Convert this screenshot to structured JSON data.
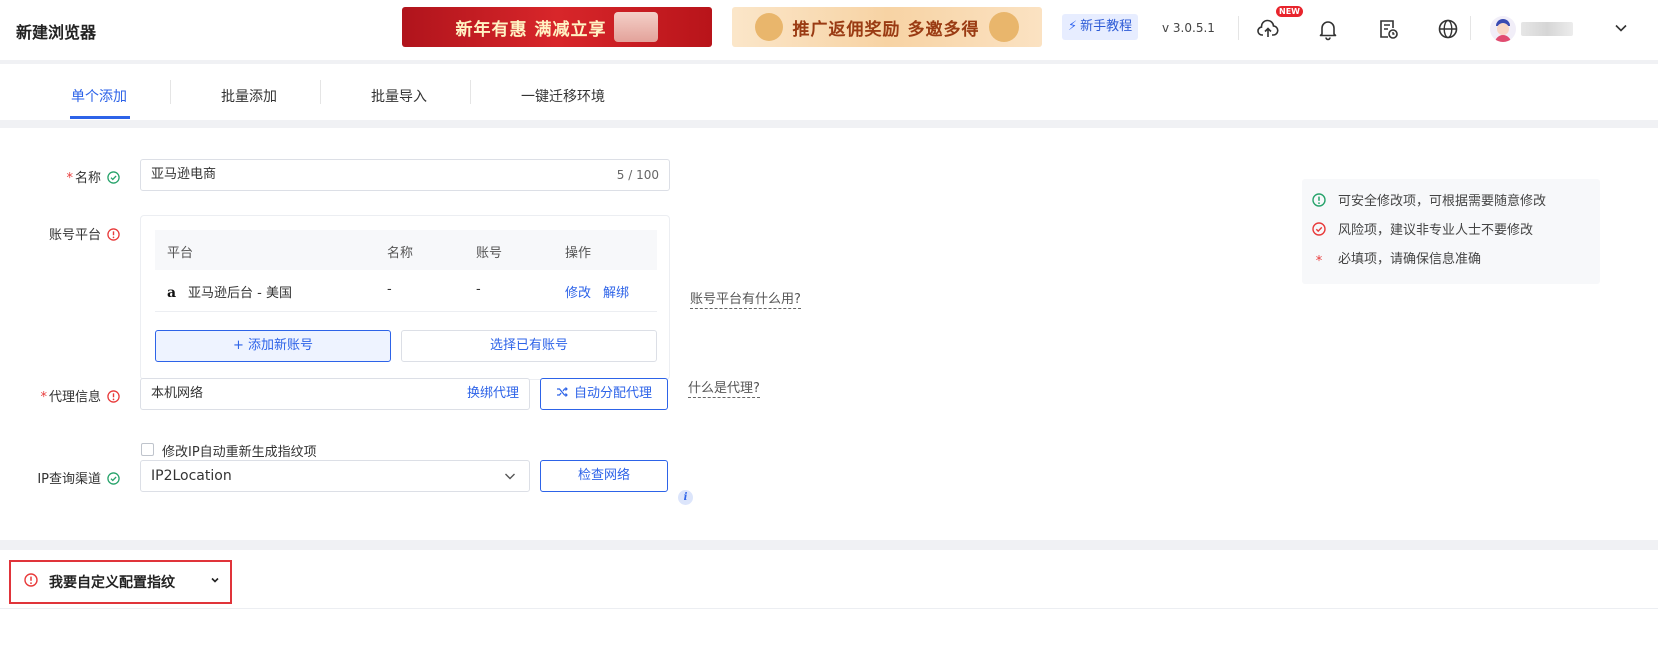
{
  "header": {
    "title": "新建浏览器",
    "banner1_text": "新年有惠 满减立享",
    "banner2_text": "推广返佣奖励 多邀多得",
    "tutorial_label": "新手教程",
    "version": "v 3.0.5.1",
    "upload_badge": "NEW",
    "icons": [
      "cloud-upload-icon",
      "bell-icon",
      "task-log-icon",
      "globe-icon",
      "avatar",
      "chevron-down-icon"
    ]
  },
  "tabs": [
    {
      "label": "单个添加",
      "active": true
    },
    {
      "label": "批量添加",
      "active": false
    },
    {
      "label": "批量导入",
      "active": false
    },
    {
      "label": "一键迁移环境",
      "active": false
    }
  ],
  "form": {
    "name": {
      "label": "名称",
      "required": true,
      "value": "亚马逊电商",
      "counter": "5 / 100"
    },
    "account_platform": {
      "label": "账号平台",
      "columns": [
        "平台",
        "名称",
        "账号",
        "操作"
      ],
      "rows": [
        {
          "platform": "亚马逊后台 - 美国",
          "name": "-",
          "account": "-",
          "action_edit": "修改",
          "action_unbind": "解绑"
        }
      ],
      "add_button": "+ 添加新账号",
      "select_button": "选择已有账号",
      "help_link": "账号平台有什么用?"
    },
    "proxy": {
      "label": "代理信息",
      "required": true,
      "value": "本机网络",
      "change_link": "换绑代理",
      "auto_button": "自动分配代理",
      "help_link": "什么是代理?",
      "checkbox_label": "修改IP自动重新生成指纹项",
      "checkbox_checked": false
    },
    "ip_channel": {
      "label": "IP查询渠道",
      "value": "IP2Location",
      "check_button": "检查网络",
      "info_icon": "i"
    }
  },
  "legend": [
    {
      "icon": "safe-icon",
      "color": "#27a36b",
      "text": "可安全修改项，可根据需要随意修改"
    },
    {
      "icon": "risk-icon",
      "color": "#e83a3a",
      "text": "风险项，建议非专业人士不要修改"
    },
    {
      "icon": "required-star",
      "color": "#e83a3a",
      "text": "必填项，请确保信息准确",
      "mark": "*"
    }
  ],
  "custom_section": {
    "title": "我要自定义配置指纹"
  },
  "colors": {
    "accent": "#2d63e8",
    "danger": "#e83a3a",
    "success": "#27a36b"
  }
}
